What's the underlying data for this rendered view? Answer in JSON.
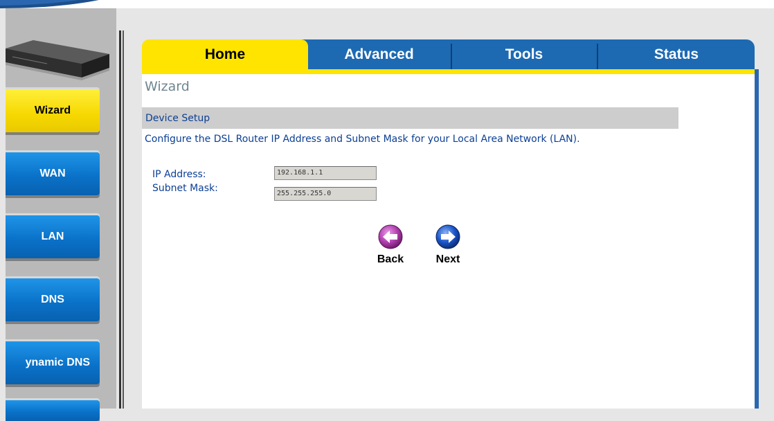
{
  "tabs": [
    {
      "label": "Home",
      "active": true
    },
    {
      "label": "Advanced",
      "active": false
    },
    {
      "label": "Tools",
      "active": false
    },
    {
      "label": "Status",
      "active": false
    }
  ],
  "sidebar": {
    "items": [
      {
        "label": "Wizard",
        "active": true
      },
      {
        "label": "WAN",
        "active": false
      },
      {
        "label": "LAN",
        "active": false
      },
      {
        "label": "DNS",
        "active": false
      },
      {
        "label": "ynamic DNS",
        "active": false
      }
    ]
  },
  "page": {
    "heading": "Wizard",
    "section_title": "Device Setup",
    "description": "Configure the DSL Router IP Address and Subnet Mask for your Local Area Network (LAN)."
  },
  "form": {
    "ip_label": "IP Address:",
    "ip_value": "192.168.1.1",
    "mask_label": "Subnet Mask:",
    "mask_value": "255.255.255.0"
  },
  "buttons": {
    "back": "Back",
    "next": "Next"
  },
  "colors": {
    "tab_blue": "#1d6ab3",
    "active_yellow": "#ffe400",
    "text_blue": "#0b3f94",
    "back_purple": "#b23fb0",
    "next_blue": "#1a55c9"
  }
}
